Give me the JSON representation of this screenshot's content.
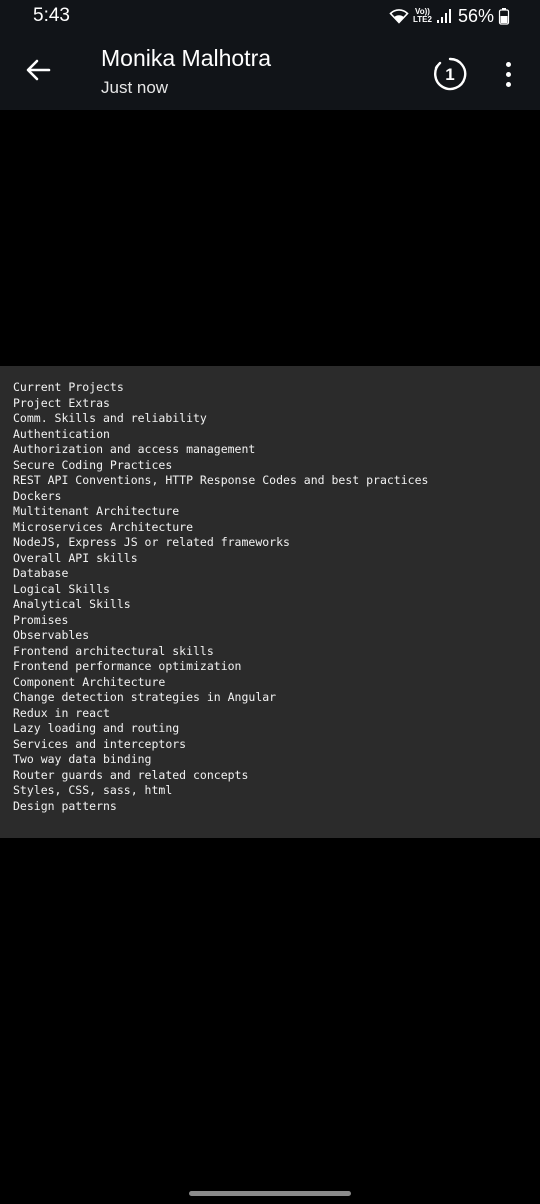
{
  "status_bar": {
    "time": "5:43",
    "network_label_top": "Vo))",
    "network_label_bottom": "LTE2",
    "battery_percent": "56%",
    "icons": [
      "wifi-icon",
      "signal-icon",
      "battery-icon"
    ]
  },
  "header": {
    "contact_name": "Monika Malhotra",
    "timestamp": "Just now",
    "view_once_label": "1",
    "icons": [
      "back-arrow-icon",
      "view-once-icon",
      "more-options-icon"
    ]
  },
  "image_text": {
    "lines": [
      "Current Projects",
      "Project Extras",
      "Comm. Skills and reliability",
      "Authentication",
      "Authorization and access management",
      "Secure Coding Practices",
      "REST API Conventions, HTTP Response Codes and best practices",
      "Dockers",
      "Multitenant Architecture",
      "Microservices Architecture",
      "NodeJS, Express JS or related frameworks",
      "Overall API skills",
      "Database",
      "Logical Skills",
      "Analytical Skills",
      "Promises",
      "Observables",
      "Frontend architectural skills",
      "Frontend performance optimization",
      "Component Architecture",
      "Change detection strategies in Angular",
      "Redux in react",
      "Lazy loading and routing",
      "Services and interceptors",
      "Two way data binding",
      "Router guards and related concepts",
      "Styles, CSS, sass, html",
      "Design patterns"
    ]
  },
  "colors": {
    "header_background": "#111418",
    "screen_background": "#000000",
    "image_background": "#2b2b2b",
    "text": "#f2f2f2"
  }
}
